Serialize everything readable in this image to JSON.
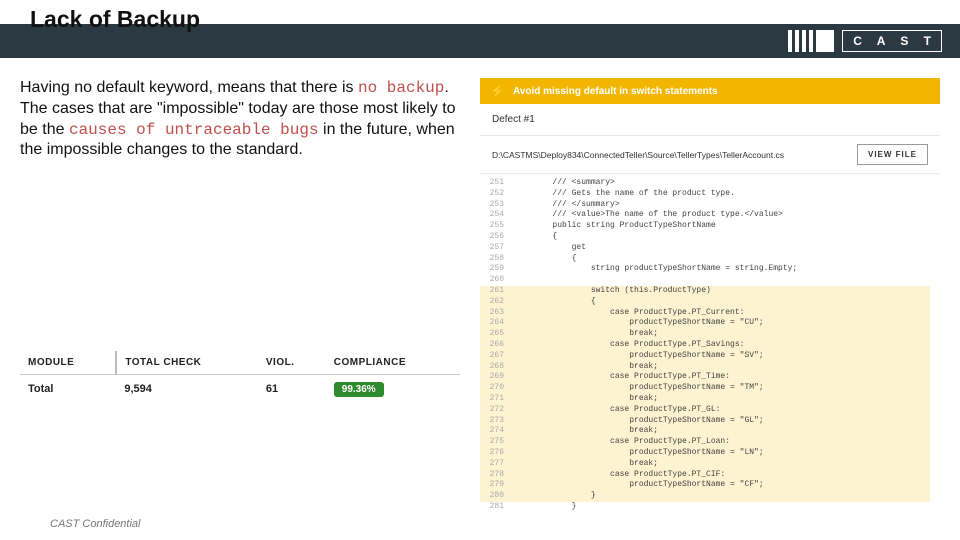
{
  "header": {
    "title": "Lack of Backup",
    "brand": "C A S T"
  },
  "paragraph": {
    "t1": "Having no default keyword, means that there is ",
    "code1": "no backup",
    "t2": ". The cases that are \"impossible\" today are those most likely to be the ",
    "code2": "causes of untraceable bugs",
    "t3": " in the future, when the impossible changes to the standard."
  },
  "metrics": {
    "headers": [
      "MODULE",
      "TOTAL CHECK",
      "VIOL.",
      "COMPLIANCE"
    ],
    "row": {
      "module": "Total",
      "total_check": "9,594",
      "viol": "61",
      "compliance": "99.36%"
    }
  },
  "report": {
    "banner_text": "Avoid missing default in switch statements",
    "defect": "Defect #1",
    "file_path": "D:\\CASTMS\\Deploy834\\ConnectedTeller\\Source\\TellerTypes\\TellerAccount.cs",
    "view_file": "VIEW FILE"
  },
  "code": [
    {
      "n": 251,
      "hl": false,
      "t": "        /// <summary>"
    },
    {
      "n": 252,
      "hl": false,
      "t": "        /// Gets the name of the product type."
    },
    {
      "n": 253,
      "hl": false,
      "t": "        /// </summary>"
    },
    {
      "n": 254,
      "hl": false,
      "t": "        /// <value>The name of the product type.</value>"
    },
    {
      "n": 255,
      "hl": false,
      "t": "        public string ProductTypeShortName"
    },
    {
      "n": 256,
      "hl": false,
      "t": "        {"
    },
    {
      "n": 257,
      "hl": false,
      "t": "            get"
    },
    {
      "n": 258,
      "hl": false,
      "t": "            {"
    },
    {
      "n": 259,
      "hl": false,
      "t": "                string productTypeShortName = string.Empty;"
    },
    {
      "n": 260,
      "hl": false,
      "t": ""
    },
    {
      "n": 261,
      "hl": true,
      "t": "                switch (this.ProductType)"
    },
    {
      "n": 262,
      "hl": true,
      "t": "                {"
    },
    {
      "n": 263,
      "hl": true,
      "t": "                    case ProductType.PT_Current:"
    },
    {
      "n": 264,
      "hl": true,
      "t": "                        productTypeShortName = \"CU\";"
    },
    {
      "n": 265,
      "hl": true,
      "t": "                        break;"
    },
    {
      "n": 266,
      "hl": true,
      "t": "                    case ProductType.PT_Savings:"
    },
    {
      "n": 267,
      "hl": true,
      "t": "                        productTypeShortName = \"SV\";"
    },
    {
      "n": 268,
      "hl": true,
      "t": "                        break;"
    },
    {
      "n": 269,
      "hl": true,
      "t": "                    case ProductType.PT_Time:"
    },
    {
      "n": 270,
      "hl": true,
      "t": "                        productTypeShortName = \"TM\";"
    },
    {
      "n": 271,
      "hl": true,
      "t": "                        break;"
    },
    {
      "n": 272,
      "hl": true,
      "t": "                    case ProductType.PT_GL:"
    },
    {
      "n": 273,
      "hl": true,
      "t": "                        productTypeShortName = \"GL\";"
    },
    {
      "n": 274,
      "hl": true,
      "t": "                        break;"
    },
    {
      "n": 275,
      "hl": true,
      "t": "                    case ProductType.PT_Loan:"
    },
    {
      "n": 276,
      "hl": true,
      "t": "                        productTypeShortName = \"LN\";"
    },
    {
      "n": 277,
      "hl": true,
      "t": "                        break;"
    },
    {
      "n": 278,
      "hl": true,
      "t": "                    case ProductType.PT_CIF:"
    },
    {
      "n": 279,
      "hl": true,
      "t": "                        productTypeShortName = \"CF\";"
    },
    {
      "n": 280,
      "hl": true,
      "t": "                }"
    },
    {
      "n": 281,
      "hl": false,
      "t": "            }"
    }
  ],
  "footer": "CAST Confidential"
}
